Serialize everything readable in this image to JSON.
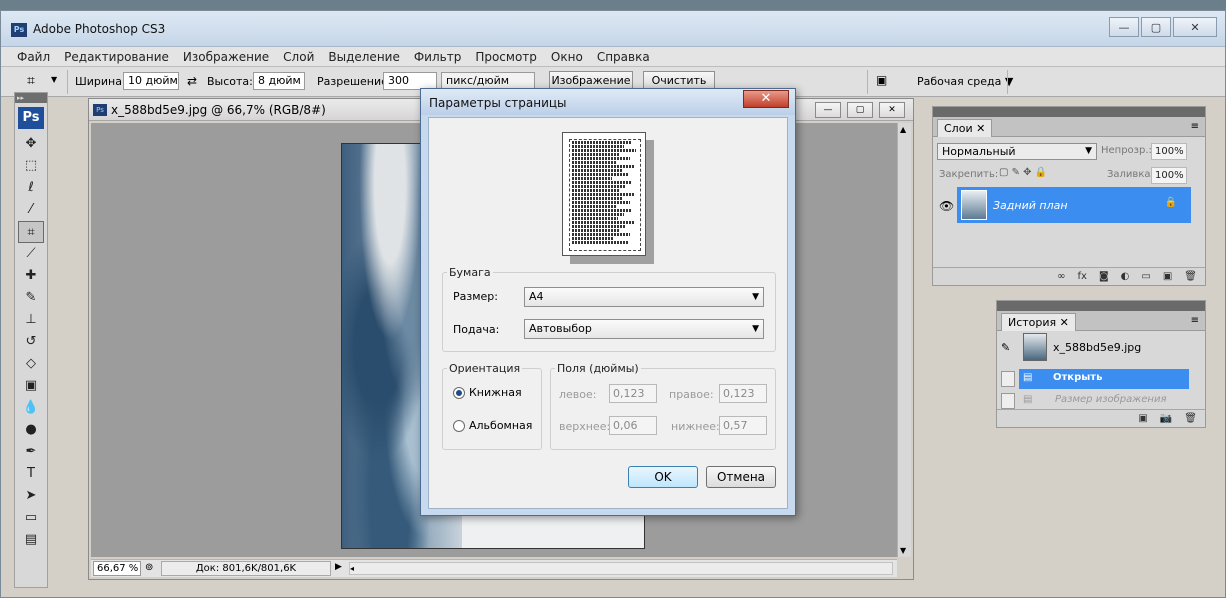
{
  "window": {
    "title": "Adobe Photoshop CS3",
    "logo": "Ps",
    "minimize_glyph": "—",
    "maximize_glyph": "▢",
    "close_glyph": "✕"
  },
  "menu": [
    "Файл",
    "Редактирование",
    "Изображение",
    "Слой",
    "Выделение",
    "Фильтр",
    "Просмотр",
    "Окно",
    "Справка"
  ],
  "options": {
    "width_label": "Ширина:",
    "width_value": "10 дюйм",
    "height_label": "Высота:",
    "height_value": "8 дюйм",
    "resolution_label": "Разрешение:",
    "resolution_value": "300",
    "resolution_unit": "пикс/дюйм",
    "image_button": "Изображение",
    "clear_button": "Очистить",
    "workspace_label": "Рабочая среда ▼"
  },
  "toolbox": {
    "logo": "Ps",
    "tools": [
      {
        "name": "move-tool",
        "glyph": "✥"
      },
      {
        "name": "marquee-tool",
        "glyph": "⬚"
      },
      {
        "name": "lasso-tool",
        "glyph": "ℓ"
      },
      {
        "name": "magic-wand-tool",
        "glyph": "⁄"
      },
      {
        "name": "crop-tool",
        "glyph": "⌗"
      },
      {
        "name": "slice-tool",
        "glyph": "⟋"
      },
      {
        "name": "healing-brush-tool",
        "glyph": "✚"
      },
      {
        "name": "brush-tool",
        "glyph": "✎"
      },
      {
        "name": "clone-stamp-tool",
        "glyph": "⊥"
      },
      {
        "name": "history-brush-tool",
        "glyph": "↺"
      },
      {
        "name": "eraser-tool",
        "glyph": "◇"
      },
      {
        "name": "gradient-tool",
        "glyph": "▣"
      },
      {
        "name": "blur-tool",
        "glyph": "💧"
      },
      {
        "name": "dodge-tool",
        "glyph": "●"
      },
      {
        "name": "pen-tool",
        "glyph": "✒"
      },
      {
        "name": "type-tool",
        "glyph": "T"
      },
      {
        "name": "path-selection-tool",
        "glyph": "➤"
      },
      {
        "name": "rectangle-tool",
        "glyph": "▭"
      },
      {
        "name": "notes-tool",
        "glyph": "▤"
      }
    ]
  },
  "document": {
    "title": "x_588bd5e9.jpg @ 66,7% (RGB/8#)",
    "zoom": "66,67 %",
    "doc_info": "Док: 801,6K/801,6K"
  },
  "layers_panel": {
    "tab": "Слои",
    "blend_mode": "Нормальный",
    "opacity_label": "Непрозр.:",
    "opacity_value": "100%",
    "lock_label": "Закрепить:",
    "fill_label": "Заливка:",
    "fill_value": "100%",
    "layer_name": "Задний план"
  },
  "history_panel": {
    "tab": "История",
    "snapshot": "x_588bd5e9.jpg",
    "items": [
      "Открыть",
      "Размер изображения"
    ]
  },
  "dialog": {
    "title": "Параметры страницы",
    "paper_legend": "Бумага",
    "size_label": "Размер:",
    "size_value": "A4",
    "source_label": "Подача:",
    "source_value": "Автовыбор",
    "orientation_legend": "Ориентация",
    "portrait": "Книжная",
    "landscape": "Альбомная",
    "margins_legend": "Поля (дюймы)",
    "left_label": "левое:",
    "left_value": "0,123",
    "right_label": "правое:",
    "right_value": "0,123",
    "top_label": "верхнее:",
    "top_value": "0,06",
    "bottom_label": "нижнее:",
    "bottom_value": "0,57",
    "ok": "OK",
    "cancel": "Отмена"
  }
}
